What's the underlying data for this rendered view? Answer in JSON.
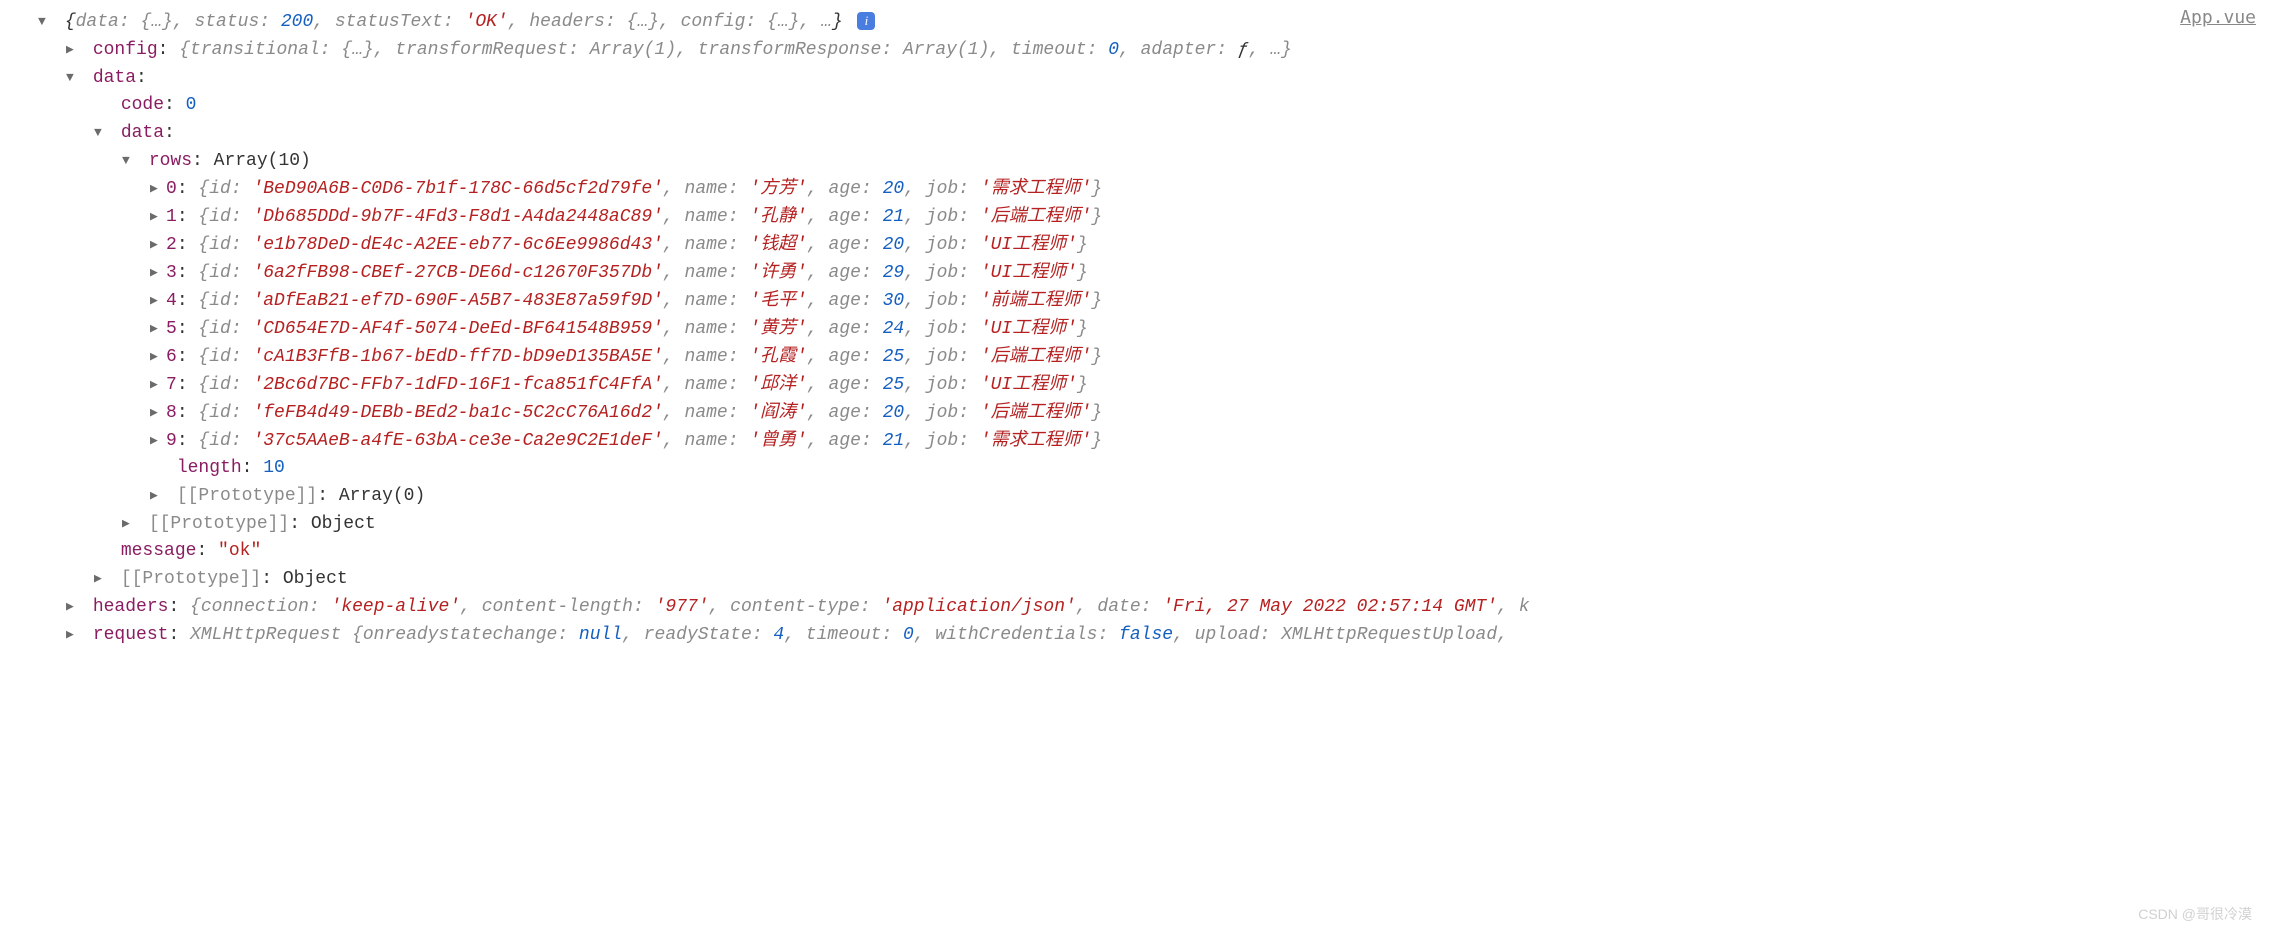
{
  "source_link": "App.vue",
  "summary": {
    "data": "{…}",
    "status": 200,
    "statusText": "'OK'",
    "headers": "{…}",
    "config": "{…}",
    "more": "…"
  },
  "config_preview": "{transitional: {…}, transformRequest: Array(1), transformResponse: Array(1), timeout: 0, adapter: ƒ, …}",
  "data": {
    "code": 0,
    "rows_label": "Array(10)",
    "rows": [
      {
        "idx": "0",
        "id": "'BeD90A6B-C0D6-7b1f-178C-66d5cf2d79fe'",
        "name": "'方芳'",
        "age": 20,
        "job": "'需求工程师'"
      },
      {
        "idx": "1",
        "id": "'Db685DDd-9b7F-4Fd3-F8d1-A4da2448aC89'",
        "name": "'孔静'",
        "age": 21,
        "job": "'后端工程师'"
      },
      {
        "idx": "2",
        "id": "'e1b78DeD-dE4c-A2EE-eb77-6c6Ee9986d43'",
        "name": "'钱超'",
        "age": 20,
        "job": "'UI工程师'"
      },
      {
        "idx": "3",
        "id": "'6a2fFB98-CBEf-27CB-DE6d-c12670F357Db'",
        "name": "'许勇'",
        "age": 29,
        "job": "'UI工程师'"
      },
      {
        "idx": "4",
        "id": "'aDfEaB21-ef7D-690F-A5B7-483E87a59f9D'",
        "name": "'毛平'",
        "age": 30,
        "job": "'前端工程师'"
      },
      {
        "idx": "5",
        "id": "'CD654E7D-AF4f-5074-DeEd-BF641548B959'",
        "name": "'黄芳'",
        "age": 24,
        "job": "'UI工程师'"
      },
      {
        "idx": "6",
        "id": "'cA1B3FfB-1b67-bEdD-ff7D-bD9eD135BA5E'",
        "name": "'孔霞'",
        "age": 25,
        "job": "'后端工程师'"
      },
      {
        "idx": "7",
        "id": "'2Bc6d7BC-FFb7-1dFD-16F1-fca851fC4FfA'",
        "name": "'邱洋'",
        "age": 25,
        "job": "'UI工程师'"
      },
      {
        "idx": "8",
        "id": "'feFB4d49-DEBb-BEd2-ba1c-5C2cC76A16d2'",
        "name": "'阎涛'",
        "age": 20,
        "job": "'后端工程师'"
      },
      {
        "idx": "9",
        "id": "'37c5AAeB-a4fE-63bA-ce3e-Ca2e9C2E1deF'",
        "name": "'曾勇'",
        "age": 21,
        "job": "'需求工程师'"
      }
    ],
    "length": 10,
    "proto_rows": "Array(0)",
    "proto_data": "Object",
    "message": "\"ok\"",
    "proto_outer": "Object"
  },
  "headers_line": {
    "connection": "'keep-alive'",
    "content_length": "'977'",
    "content_type": "'application/json'",
    "date": "'Fri, 27 May 2022 02:57:14 GMT'"
  },
  "request_line": "XMLHttpRequest {onreadystatechange: null, readyState: 4, timeout: 0, withCredentials: false, upload: XMLHttpRequestUpload,",
  "watermark": "CSDN @哥很冷漠"
}
